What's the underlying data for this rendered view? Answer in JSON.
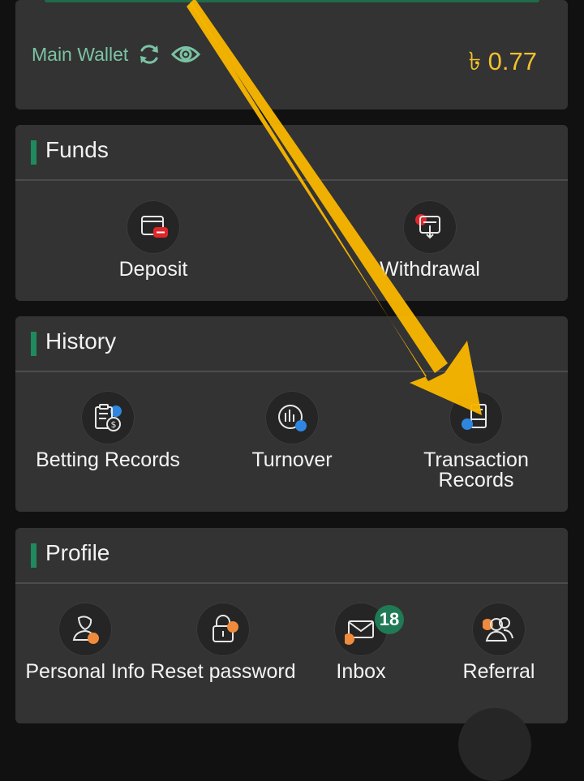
{
  "wallet": {
    "label": "Main Wallet",
    "balance": "৳ 0.77",
    "refresh_icon": "refresh-icon",
    "eye_icon": "eye-icon",
    "label_color": "#7bc3a5",
    "balance_color": "#f2c12e"
  },
  "funds": {
    "title": "Funds",
    "items": [
      {
        "label": "Deposit",
        "icon": "deposit-icon"
      },
      {
        "label": "Withdrawal",
        "icon": "withdrawal-icon"
      }
    ]
  },
  "history": {
    "title": "History",
    "items": [
      {
        "label": "Betting Records",
        "icon": "betting-records-icon"
      },
      {
        "label": "Turnover",
        "icon": "turnover-icon"
      },
      {
        "label": "Transaction Records",
        "icon": "transaction-records-icon"
      }
    ]
  },
  "profile": {
    "title": "Profile",
    "items": [
      {
        "label": "Personal Info",
        "icon": "personal-info-icon"
      },
      {
        "label": "Reset password",
        "icon": "reset-password-icon"
      },
      {
        "label": "Inbox",
        "icon": "inbox-icon",
        "badge": "18"
      },
      {
        "label": "Referral",
        "icon": "referral-icon"
      }
    ]
  },
  "overlay": {
    "arrow_icon": "pointer-arrow",
    "arrow_color": "#f7b500"
  },
  "colors": {
    "background": "#111111",
    "card": "#333333",
    "accent": "#1f8a5d",
    "badge": "#1f7a55"
  }
}
